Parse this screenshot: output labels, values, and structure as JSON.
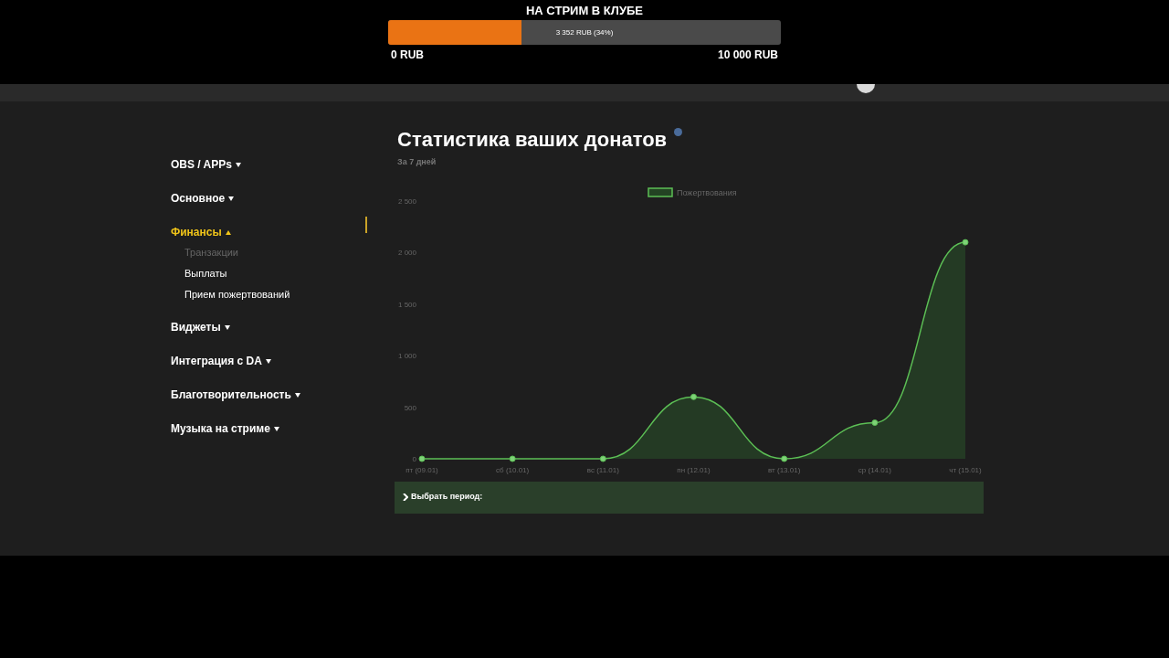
{
  "goal": {
    "title": "НА СТРИМ В КЛУБЕ",
    "level": 0.34,
    "reading": "3 352 RUB (34%)",
    "min_label": "0 RUB",
    "max_label": "10 000 RUB"
  },
  "sidebar": {
    "items": [
      {
        "label": "OBS / APPs",
        "expanded": false,
        "selected": false
      },
      {
        "label": "Основное",
        "expanded": false,
        "selected": false
      },
      {
        "label": "Финансы",
        "expanded": true,
        "selected": true,
        "children": [
          {
            "label": "Транзакции",
            "selected": true
          },
          {
            "label": "Выплаты",
            "selected": false
          },
          {
            "label": "Прием пожертвований",
            "selected": false
          }
        ]
      },
      {
        "label": "Виджеты",
        "expanded": false,
        "selected": false
      },
      {
        "label": "Интеграция с DA",
        "expanded": false,
        "selected": false
      },
      {
        "label": "Благотворительность",
        "expanded": false,
        "selected": false
      },
      {
        "label": "Музыка на стриме",
        "expanded": false,
        "selected": false
      }
    ]
  },
  "page": {
    "title": "Статистика ваших донатов",
    "subtitle": "За 7 дней",
    "chart_data": {
      "type": "area",
      "categories": [
        "пт (09.01)",
        "сб (10.01)",
        "вс (11.01)",
        "пн (12.01)",
        "вт (13.01)",
        "ср (14.01)",
        "чт (15.01)"
      ],
      "series": [
        {
          "name": "Пожертвования",
          "color": "#5cbf55",
          "values": [
            0,
            0,
            0,
            600,
            0,
            350,
            2100
          ]
        }
      ],
      "ylim": [
        0,
        2500
      ],
      "yticks": [
        {
          "value": 0,
          "label": "0"
        },
        {
          "value": 500,
          "label": "500"
        },
        {
          "value": 1000,
          "label": "1 000"
        },
        {
          "value": 1500,
          "label": "1 500"
        },
        {
          "value": 2000,
          "label": "2 000"
        },
        {
          "value": 2500,
          "label": "2 500"
        }
      ]
    },
    "period": {
      "label": "Выбрать период:",
      "expanded": false
    }
  }
}
